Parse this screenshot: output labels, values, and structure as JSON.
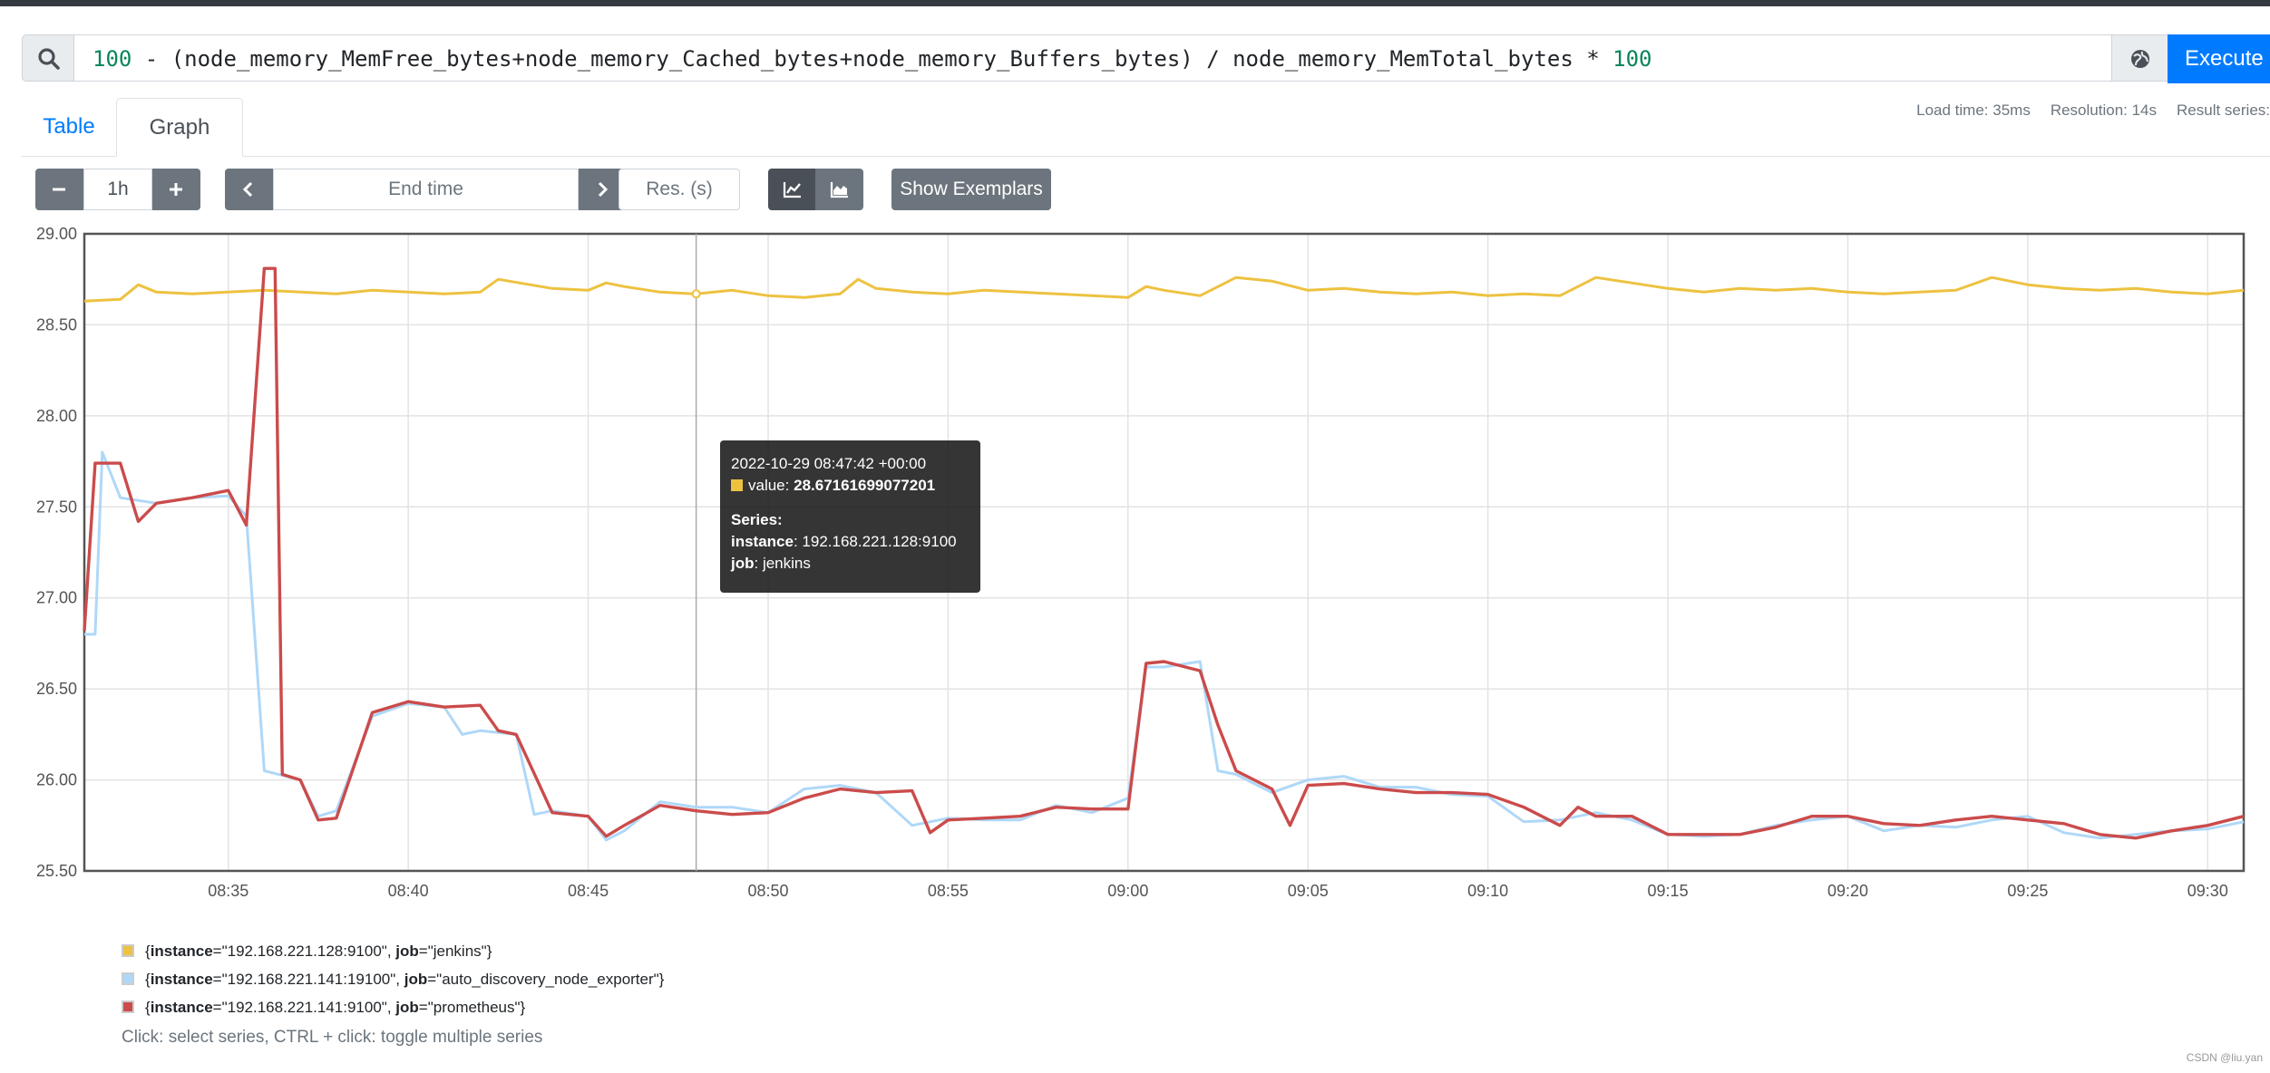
{
  "query": {
    "expression_parts": [
      {
        "text": "100",
        "kind": "num"
      },
      {
        "text": " - (node_memory_MemFree_bytes+node_memory_Cached_bytes+node_memory_Buffers_bytes) / node_memory_MemTotal_bytes * ",
        "kind": "txt"
      },
      {
        "text": "100",
        "kind": "num"
      }
    ],
    "execute_label": "Execute"
  },
  "tabs": {
    "table": "Table",
    "graph": "Graph"
  },
  "stats": {
    "load_time": "Load time: 35ms",
    "resolution": "Resolution: 14s",
    "result_series": "Result series:"
  },
  "controls": {
    "range": "1h",
    "end_time_placeholder": "End time",
    "res_placeholder": "Res. (s)",
    "show_exemplars": "Show Exemplars"
  },
  "tooltip": {
    "timestamp": "2022-10-29 08:47:42 +00:00",
    "value_label": "value:",
    "value": "28.67161699077201",
    "series_label": "Series:",
    "instance_label": "instance",
    "instance_value": ": 192.168.221.128:9100",
    "job_label": "job",
    "job_value": ": jenkins"
  },
  "legend": [
    {
      "color": "#edc240",
      "instance": "\"192.168.221.128:9100\"",
      "job": "\"jenkins\""
    },
    {
      "color": "#afd8f8",
      "instance": "\"192.168.221.141:19100\"",
      "job": "\"auto_discovery_node_exporter\""
    },
    {
      "color": "#cb4b4b",
      "instance": "\"192.168.221.141:9100\"",
      "job": "\"prometheus\""
    }
  ],
  "legend_hint": "Click: select series, CTRL + click: toggle multiple series",
  "watermark": "CSDN @liu.yan",
  "chart_data": {
    "type": "line",
    "x_start": "08:31",
    "x_end": "09:31",
    "x_ticks": [
      "08:35",
      "08:40",
      "08:45",
      "08:50",
      "08:55",
      "09:00",
      "09:05",
      "09:10",
      "09:15",
      "09:20",
      "09:25",
      "09:30"
    ],
    "y_ticks": [
      "25.50",
      "26.00",
      "26.50",
      "27.00",
      "27.50",
      "28.00",
      "28.50",
      "29.00"
    ],
    "ylim": [
      25.5,
      29.0
    ],
    "grid": true,
    "hover_time": "08:48",
    "series": [
      {
        "name": "{instance=\"192.168.221.128:9100\", job=\"jenkins\"}",
        "color": "#edc240",
        "points": [
          [
            "08:31",
            28.63
          ],
          [
            "08:32",
            28.64
          ],
          [
            "08:32.5",
            28.72
          ],
          [
            "08:33",
            28.68
          ],
          [
            "08:34",
            28.67
          ],
          [
            "08:35",
            28.68
          ],
          [
            "08:36",
            28.69
          ],
          [
            "08:37",
            28.68
          ],
          [
            "08:38",
            28.67
          ],
          [
            "08:39",
            28.69
          ],
          [
            "08:40",
            28.68
          ],
          [
            "08:41",
            28.67
          ],
          [
            "08:42",
            28.68
          ],
          [
            "08:42.5",
            28.75
          ],
          [
            "08:44",
            28.7
          ],
          [
            "08:45",
            28.69
          ],
          [
            "08:45.5",
            28.73
          ],
          [
            "08:46",
            28.71
          ],
          [
            "08:47",
            28.68
          ],
          [
            "08:48",
            28.67
          ],
          [
            "08:49",
            28.69
          ],
          [
            "08:50",
            28.66
          ],
          [
            "08:51",
            28.65
          ],
          [
            "08:52",
            28.67
          ],
          [
            "08:52.5",
            28.75
          ],
          [
            "08:53",
            28.7
          ],
          [
            "08:54",
            28.68
          ],
          [
            "08:55",
            28.67
          ],
          [
            "08:56",
            28.69
          ],
          [
            "08:57",
            28.68
          ],
          [
            "08:58",
            28.67
          ],
          [
            "08:59",
            28.66
          ],
          [
            "09:00",
            28.65
          ],
          [
            "09:00.5",
            28.71
          ],
          [
            "09:01",
            28.69
          ],
          [
            "09:02",
            28.66
          ],
          [
            "09:03",
            28.76
          ],
          [
            "09:04",
            28.74
          ],
          [
            "09:05",
            28.69
          ],
          [
            "09:06",
            28.7
          ],
          [
            "09:07",
            28.68
          ],
          [
            "09:08",
            28.67
          ],
          [
            "09:09",
            28.68
          ],
          [
            "09:10",
            28.66
          ],
          [
            "09:11",
            28.67
          ],
          [
            "09:12",
            28.66
          ],
          [
            "09:13",
            28.76
          ],
          [
            "09:14",
            28.73
          ],
          [
            "09:15",
            28.7
          ],
          [
            "09:16",
            28.68
          ],
          [
            "09:17",
            28.7
          ],
          [
            "09:18",
            28.69
          ],
          [
            "09:19",
            28.7
          ],
          [
            "09:20",
            28.68
          ],
          [
            "09:21",
            28.67
          ],
          [
            "09:22",
            28.68
          ],
          [
            "09:23",
            28.69
          ],
          [
            "09:24",
            28.76
          ],
          [
            "09:25",
            28.72
          ],
          [
            "09:26",
            28.7
          ],
          [
            "09:27",
            28.69
          ],
          [
            "09:28",
            28.7
          ],
          [
            "09:29",
            28.68
          ],
          [
            "09:30",
            28.67
          ],
          [
            "09:31",
            28.69
          ]
        ]
      },
      {
        "name": "{instance=\"192.168.221.141:19100\", job=\"auto_discovery_node_exporter\"}",
        "color": "#afd8f8",
        "points": [
          [
            "08:31",
            26.8
          ],
          [
            "08:31.3",
            26.8
          ],
          [
            "08:31.5",
            27.8
          ],
          [
            "08:32",
            27.55
          ],
          [
            "08:33",
            27.52
          ],
          [
            "08:34",
            27.55
          ],
          [
            "08:35",
            27.56
          ],
          [
            "08:35.5",
            27.45
          ],
          [
            "08:36",
            26.05
          ],
          [
            "08:37",
            26.0
          ],
          [
            "08:37.5",
            25.8
          ],
          [
            "08:38",
            25.83
          ],
          [
            "08:39",
            26.35
          ],
          [
            "08:40",
            26.42
          ],
          [
            "08:41",
            26.4
          ],
          [
            "08:41.5",
            26.25
          ],
          [
            "08:42",
            26.27
          ],
          [
            "08:43",
            26.25
          ],
          [
            "08:43.5",
            25.81
          ],
          [
            "08:44",
            25.83
          ],
          [
            "08:45",
            25.8
          ],
          [
            "08:45.5",
            25.67
          ],
          [
            "08:46",
            25.72
          ],
          [
            "08:47",
            25.88
          ],
          [
            "08:48",
            25.85
          ],
          [
            "08:49",
            25.85
          ],
          [
            "08:50",
            25.82
          ],
          [
            "08:51",
            25.95
          ],
          [
            "08:52",
            25.97
          ],
          [
            "08:53",
            25.93
          ],
          [
            "08:54",
            25.75
          ],
          [
            "08:55",
            25.79
          ],
          [
            "08:56",
            25.78
          ],
          [
            "08:57",
            25.78
          ],
          [
            "08:58",
            25.86
          ],
          [
            "08:59",
            25.82
          ],
          [
            "09:00",
            25.9
          ],
          [
            "09:00.5",
            26.62
          ],
          [
            "09:01",
            26.62
          ],
          [
            "09:02",
            26.65
          ],
          [
            "09:02.5",
            26.05
          ],
          [
            "09:03",
            26.03
          ],
          [
            "09:04",
            25.93
          ],
          [
            "09:05",
            26.0
          ],
          [
            "09:06",
            26.02
          ],
          [
            "09:07",
            25.96
          ],
          [
            "09:08",
            25.96
          ],
          [
            "09:09",
            25.92
          ],
          [
            "09:10",
            25.91
          ],
          [
            "09:11",
            25.77
          ],
          [
            "09:12",
            25.78
          ],
          [
            "09:13",
            25.82
          ],
          [
            "09:14",
            25.78
          ],
          [
            "09:15",
            25.7
          ],
          [
            "09:16",
            25.69
          ],
          [
            "09:17",
            25.7
          ],
          [
            "09:18",
            25.75
          ],
          [
            "09:19",
            25.78
          ],
          [
            "09:20",
            25.8
          ],
          [
            "09:21",
            25.72
          ],
          [
            "09:22",
            25.75
          ],
          [
            "09:23",
            25.74
          ],
          [
            "09:24",
            25.78
          ],
          [
            "09:25",
            25.8
          ],
          [
            "09:26",
            25.71
          ],
          [
            "09:27",
            25.68
          ],
          [
            "09:28",
            25.7
          ],
          [
            "09:29",
            25.72
          ],
          [
            "09:30",
            25.73
          ],
          [
            "09:31",
            25.77
          ]
        ]
      },
      {
        "name": "{instance=\"192.168.221.141:9100\", job=\"prometheus\"}",
        "color": "#cb4b4b",
        "points": [
          [
            "08:31",
            26.82
          ],
          [
            "08:31.3",
            27.74
          ],
          [
            "08:32",
            27.74
          ],
          [
            "08:32.5",
            27.42
          ],
          [
            "08:33",
            27.52
          ],
          [
            "08:34",
            27.55
          ],
          [
            "08:35",
            27.59
          ],
          [
            "08:35.5",
            27.4
          ],
          [
            "08:36",
            28.81
          ],
          [
            "08:36.3",
            28.81
          ],
          [
            "08:36.5",
            26.03
          ],
          [
            "08:37",
            26.0
          ],
          [
            "08:37.5",
            25.78
          ],
          [
            "08:38",
            25.79
          ],
          [
            "08:39",
            26.37
          ],
          [
            "08:40",
            26.43
          ],
          [
            "08:41",
            26.4
          ],
          [
            "08:42",
            26.41
          ],
          [
            "08:42.5",
            26.27
          ],
          [
            "08:43",
            26.25
          ],
          [
            "08:44",
            25.82
          ],
          [
            "08:45",
            25.8
          ],
          [
            "08:45.5",
            25.69
          ],
          [
            "08:46",
            25.75
          ],
          [
            "08:47",
            25.86
          ],
          [
            "08:48",
            25.83
          ],
          [
            "08:49",
            25.81
          ],
          [
            "08:50",
            25.82
          ],
          [
            "08:51",
            25.9
          ],
          [
            "08:52",
            25.95
          ],
          [
            "08:53",
            25.93
          ],
          [
            "08:54",
            25.94
          ],
          [
            "08:54.5",
            25.71
          ],
          [
            "08:55",
            25.78
          ],
          [
            "08:56",
            25.79
          ],
          [
            "08:57",
            25.8
          ],
          [
            "08:58",
            25.85
          ],
          [
            "08:59",
            25.84
          ],
          [
            "09:00",
            25.84
          ],
          [
            "09:00.5",
            26.64
          ],
          [
            "09:01",
            26.65
          ],
          [
            "09:02",
            26.6
          ],
          [
            "09:02.5",
            26.3
          ],
          [
            "09:03",
            26.05
          ],
          [
            "09:04",
            25.95
          ],
          [
            "09:04.5",
            25.75
          ],
          [
            "09:05",
            25.97
          ],
          [
            "09:06",
            25.98
          ],
          [
            "09:07",
            25.95
          ],
          [
            "09:08",
            25.93
          ],
          [
            "09:09",
            25.93
          ],
          [
            "09:10",
            25.92
          ],
          [
            "09:11",
            25.85
          ],
          [
            "09:12",
            25.75
          ],
          [
            "09:12.5",
            25.85
          ],
          [
            "09:13",
            25.8
          ],
          [
            "09:14",
            25.8
          ],
          [
            "09:15",
            25.7
          ],
          [
            "09:16",
            25.7
          ],
          [
            "09:17",
            25.7
          ],
          [
            "09:18",
            25.74
          ],
          [
            "09:19",
            25.8
          ],
          [
            "09:20",
            25.8
          ],
          [
            "09:21",
            25.76
          ],
          [
            "09:22",
            25.75
          ],
          [
            "09:23",
            25.78
          ],
          [
            "09:24",
            25.8
          ],
          [
            "09:25",
            25.78
          ],
          [
            "09:26",
            25.76
          ],
          [
            "09:27",
            25.7
          ],
          [
            "09:28",
            25.68
          ],
          [
            "09:29",
            25.72
          ],
          [
            "09:30",
            25.75
          ],
          [
            "09:31",
            25.8
          ]
        ]
      }
    ]
  }
}
